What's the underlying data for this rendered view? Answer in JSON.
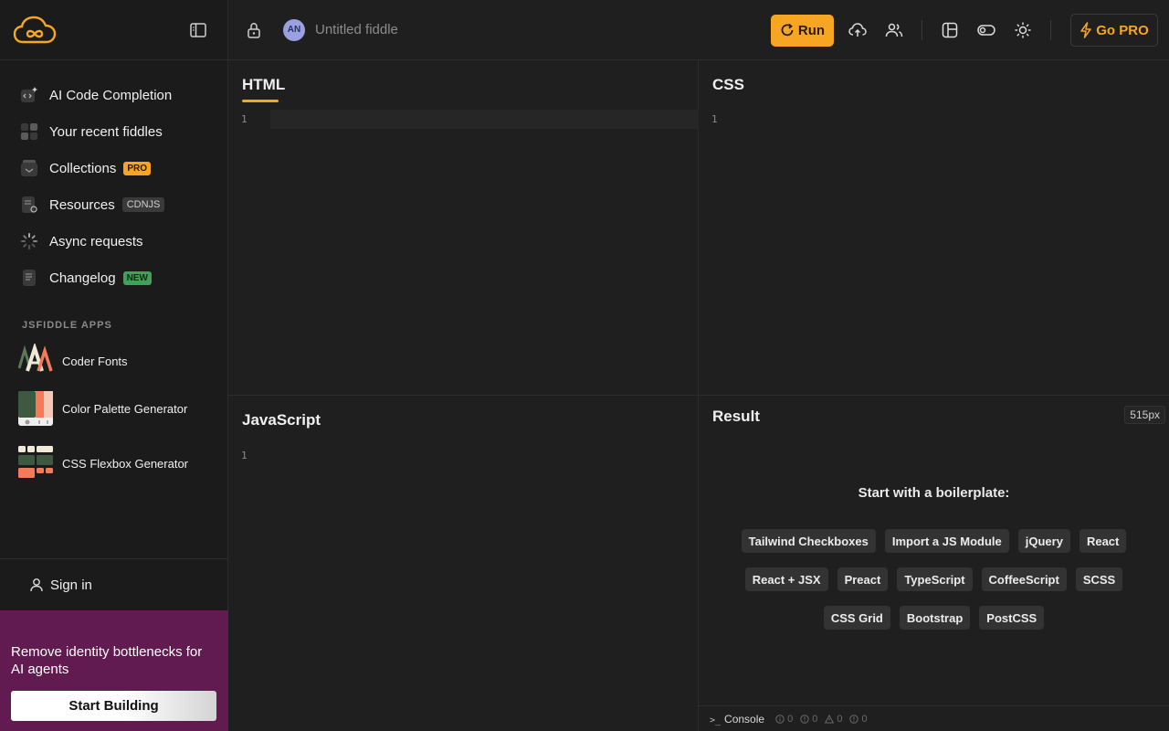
{
  "sidebar": {
    "items": [
      {
        "label": "AI Code Completion",
        "icon": "ai-code-icon",
        "badge": ""
      },
      {
        "label": "Your recent fiddles",
        "icon": "grid-icon",
        "badge": ""
      },
      {
        "label": "Collections",
        "icon": "collections-icon",
        "badge": "PRO"
      },
      {
        "label": "Resources",
        "icon": "resources-icon",
        "badge": "CDNJS"
      },
      {
        "label": "Async requests",
        "icon": "spinner-icon",
        "badge": ""
      },
      {
        "label": "Changelog",
        "icon": "changelog-icon",
        "badge": "NEW"
      }
    ],
    "apps_title": "JSFIDDLE APPS",
    "apps": [
      {
        "label": "Coder Fonts"
      },
      {
        "label": "Color Palette Generator"
      },
      {
        "label": "CSS Flexbox Generator"
      }
    ],
    "sign_in": "Sign in",
    "promo": {
      "text": "Remove identity bottlenecks for AI agents",
      "button": "Start Building"
    }
  },
  "topbar": {
    "avatar_initials": "AN",
    "fiddle_title": "Untitled fiddle",
    "run_label": "Run",
    "go_pro_label": "Go PRO"
  },
  "panels": {
    "html": {
      "title": "HTML",
      "line": "1"
    },
    "css": {
      "title": "CSS",
      "line": "1"
    },
    "js": {
      "title": "JavaScript",
      "line": "1"
    },
    "result": {
      "title": "Result",
      "width_tag": "515px",
      "boilerplate_title": "Start with a boilerplate:",
      "boilerplates": [
        [
          "Tailwind Checkboxes",
          "Import a JS Module",
          "jQuery",
          "React"
        ],
        [
          "React + JSX",
          "Preact",
          "TypeScript",
          "CoffeeScript",
          "SCSS"
        ],
        [
          "CSS Grid",
          "Bootstrap",
          "PostCSS"
        ]
      ]
    }
  },
  "console": {
    "label": "Console",
    "counts": [
      "0",
      "0",
      "0",
      "0"
    ]
  },
  "colors": {
    "accent": "#f6a623",
    "promo_bg": "#621b50",
    "new_badge": "#3fa357"
  }
}
